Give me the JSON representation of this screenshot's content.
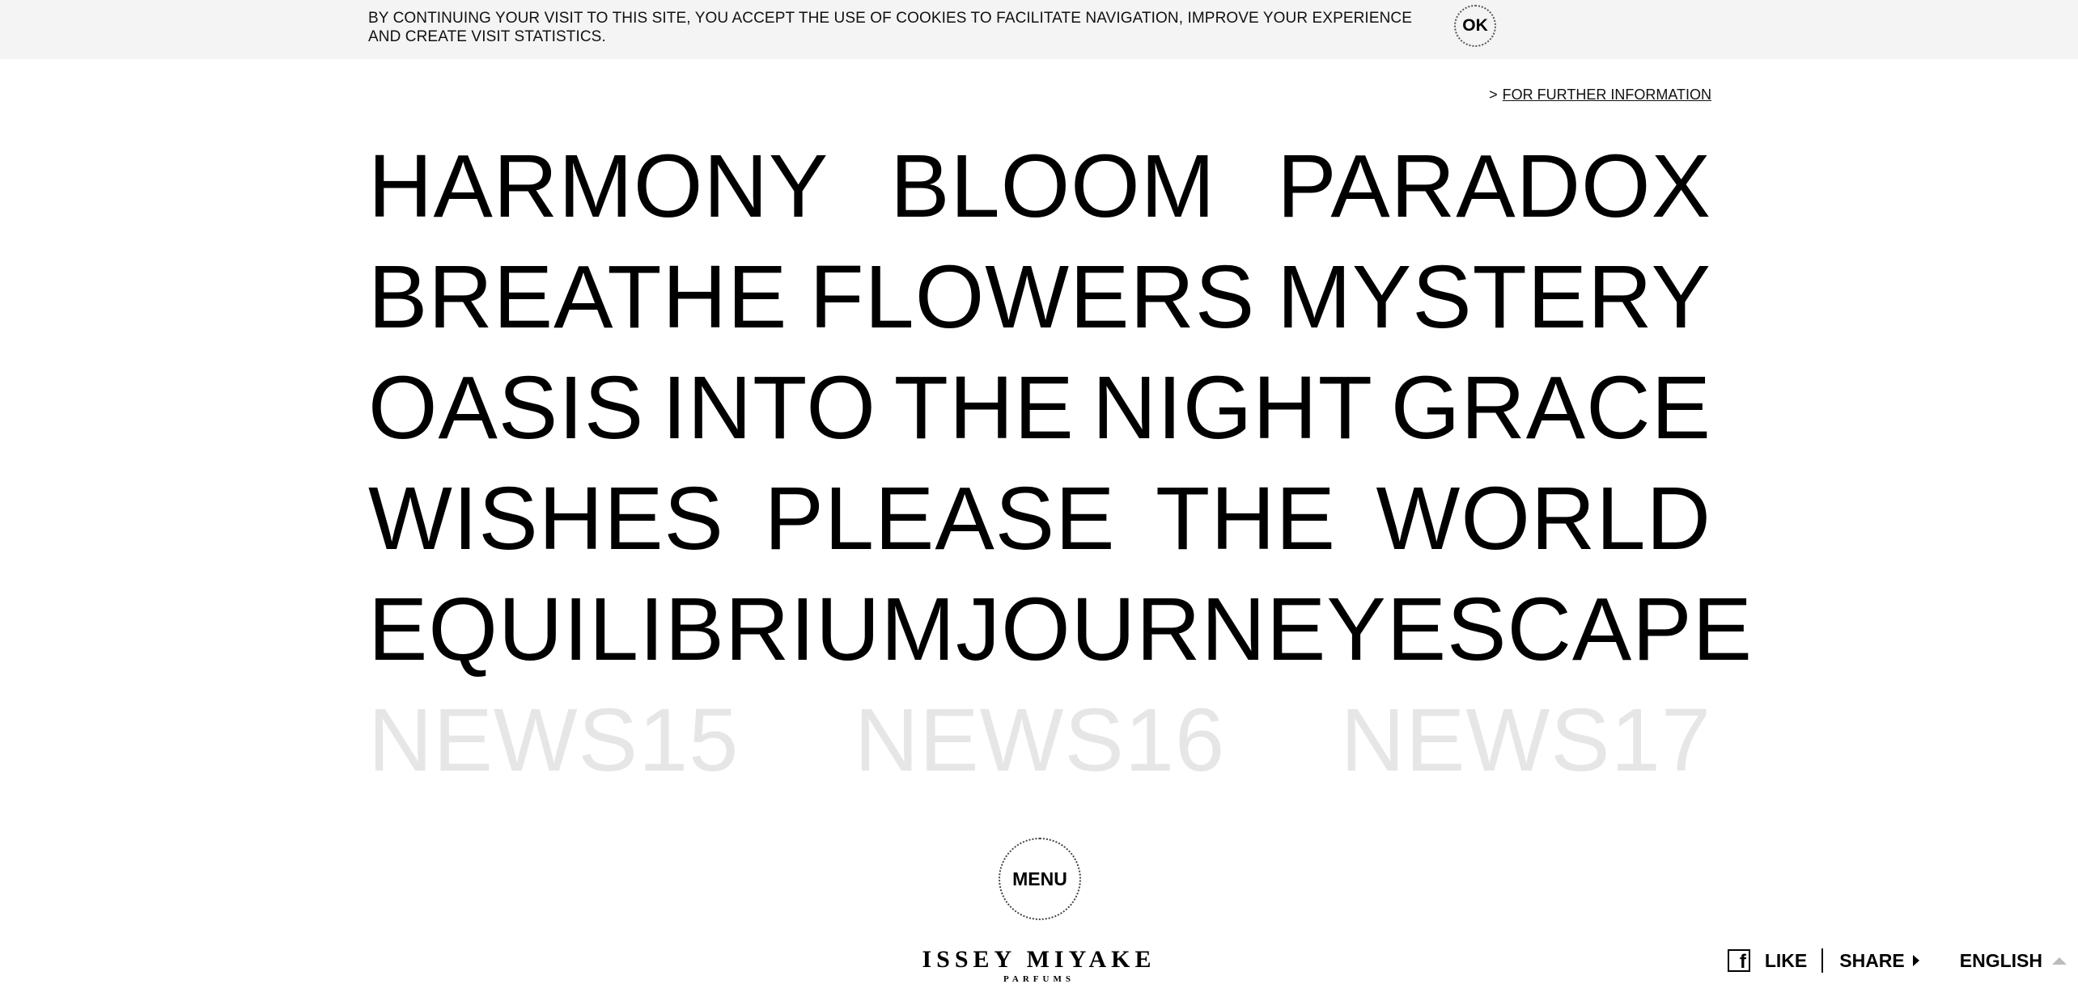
{
  "cookie_bar": {
    "message": "BY CONTINUING YOUR VISIT TO THIS SITE, YOU ACCEPT THE USE OF COOKIES TO FACILITATE NAVIGATION, IMPROVE YOUR EXPERIENCE AND CREATE VISIT STATISTICS.",
    "ok_label": "OK"
  },
  "further_info": {
    "prefix": ">",
    "link_label": "FOR FURTHER INFORMATION"
  },
  "grid": {
    "rows": [
      [
        "HARMONY",
        "BLOOM",
        "PARADOX"
      ],
      [
        "BREATHE",
        "FLOWERS",
        "MYSTERY"
      ],
      [
        "OASIS",
        "INTO",
        "THE",
        "NIGHT",
        "GRACE"
      ],
      [
        "WISHES",
        "PLEASE",
        "THE",
        "WORLD"
      ],
      [
        "EQUILIBRIUM",
        "JOURNEY",
        "ESCAPE"
      ],
      [
        "NEWS15",
        "NEWS16",
        "NEWS17"
      ]
    ]
  },
  "menu": {
    "label": "MENU"
  },
  "logo": {
    "main": "ISSEY MIYAKE",
    "sub": "PARFUMS"
  },
  "footer": {
    "facebook_icon": "f",
    "like_label": "LIKE",
    "share_label": "SHARE",
    "language_label": "ENGLISH"
  },
  "colors": {
    "cookie_bg": "#f4f4f4",
    "faded_word": "#e6e6e6",
    "text": "#000000"
  }
}
